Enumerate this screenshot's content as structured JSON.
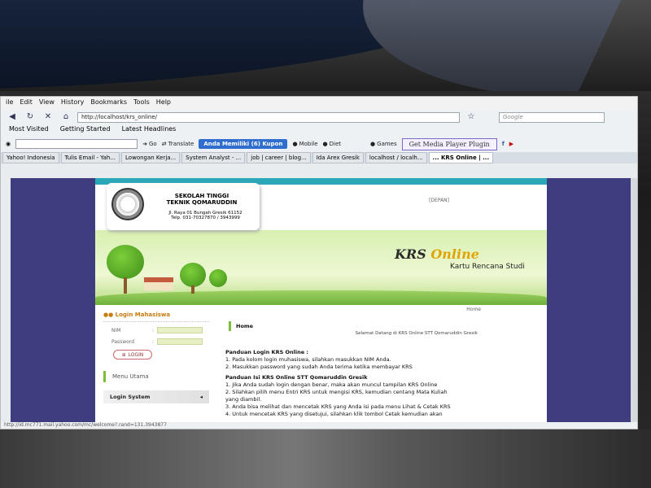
{
  "browser": {
    "menus": [
      "ile",
      "Edit",
      "View",
      "History",
      "Bookmarks",
      "Tools",
      "Help"
    ],
    "url": "http://localhost/krs_online/",
    "search_placeholder": "Google",
    "bookmarks": [
      "Most Visited",
      "Getting Started",
      "Latest Headlines"
    ],
    "toolbar": {
      "go": "Go",
      "translate": "Translate",
      "kupon": "Anda Memiliki (6) Kupon",
      "mobile": "Mobile",
      "diet": "Diet",
      "games": "Games",
      "media_plugin": "Get Media Player Plugin"
    },
    "tabs": [
      "Yahoo! Indonesia",
      "Tulis Email - Yah...",
      "Lowongan Kerja...",
      "System Analyst - ...",
      "job | career | blog...",
      "Ida Arex Gresik",
      "localhost / localh...",
      "... KRS Online | ..."
    ],
    "status_text": "http://id.mc771.mail.yahoo.com/mc/welcome?.rand=131.3943877"
  },
  "site": {
    "school_name": "SEKOLAH TINGGI TEKNIK QOMARUDDIN",
    "school_address": "Jl. Raya 01 Bungah Gresik 61152",
    "school_phone": "Telp. 031-70327870 / 3943999",
    "depan": "[DEPAN]",
    "krs_title_a": "KRS",
    "krs_title_b": "Online",
    "krs_subtitle": "Kartu Rencana Studi",
    "login_heading": "Login Mahasiswa",
    "nim_label": "NIM",
    "password_label": "Password",
    "colon": ":",
    "login_button": "LOGIN",
    "menu_heading": "Menu Utama",
    "menu_item": "Login System",
    "home_link": "Home",
    "home_bar": "Home",
    "welcome": "Selamat Datang di KRS Online STT Qomaruddin Gresik",
    "panduan_login_head": "Panduan Login KRS Online :",
    "panduan_login": [
      "1.  Pada kolom login muhasiswa, silahkan masukkan NIM Anda.",
      "2.  Masukkan password yang sudah Anda terima ketika membayar KRS"
    ],
    "panduan_isi_head": "Panduan Isi KRS Online STT Qomaruddin Gresik",
    "panduan_isi": [
      "1.  Jika Anda sudah login dengan benar, maka akan muncul tampilan KRS Online",
      "2.  Silahkan pilih menu Entri KRS untuk mengisi KRS, kemudian centang Mata Kuliah",
      "     yang diambil.",
      "3.  Anda bisa melihat dan mencetak KRS yang Anda isi pada menu Lihat & Cetak KRS",
      "4.  Untuk mencetak KRS yang disetujui, silahkan klik tombol Cetak kemudian akan"
    ]
  },
  "colors": {
    "page_bg": "#3d3d7f",
    "accent_teal": "#2aa7b8",
    "accent_orange": "#c77c10"
  }
}
